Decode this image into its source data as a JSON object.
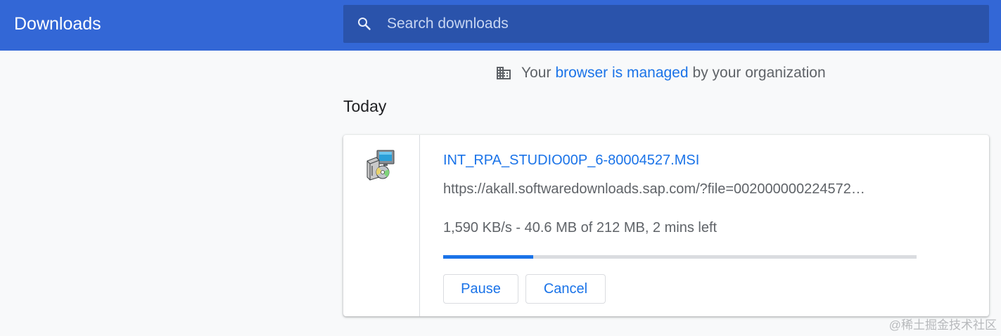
{
  "header": {
    "title": "Downloads",
    "accent_color": "#3367d6"
  },
  "search": {
    "placeholder": "Search downloads",
    "value": "",
    "icon": "search-icon"
  },
  "managed_notice": {
    "prefix": "Your",
    "link_text": "browser is managed",
    "suffix": "by your organization",
    "icon": "building-icon"
  },
  "groups": [
    {
      "date_label": "Today",
      "items": [
        {
          "file_name": "INT_RPA_STUDIO00P_6-80004527.MSI",
          "url": "https://akall.softwaredownloads.sap.com/?file=002000000224572…",
          "status": "1,590 KB/s - 40.6 MB of 212 MB, 2 mins left",
          "progress": 0.19,
          "icon": "installer-file-icon",
          "actions": {
            "pause_label": "Pause",
            "cancel_label": "Cancel"
          }
        }
      ]
    }
  ],
  "watermark": "@稀土掘金技术社区"
}
